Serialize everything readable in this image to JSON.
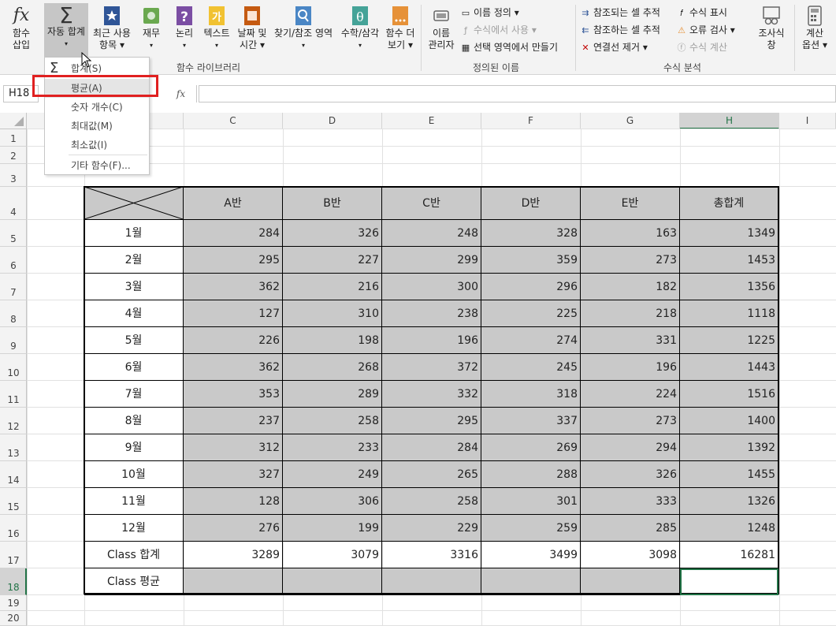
{
  "ribbon": {
    "insert_function": {
      "icon": "fx-icon",
      "line1": "함수",
      "line2": "삽입"
    },
    "autosum": {
      "icon": "sigma-icon",
      "line1": "자동 합계"
    },
    "recent": {
      "line1": "최근 사용",
      "line2": "항목"
    },
    "financial": {
      "line1": "재무"
    },
    "logical": {
      "line1": "논리"
    },
    "text": {
      "line1": "텍스트"
    },
    "datetime": {
      "line1": "날짜 및",
      "line2": "시간"
    },
    "lookup": {
      "line1": "찾기/참조 영역"
    },
    "math": {
      "line1": "수학/삼각"
    },
    "more": {
      "line1": "함수 더",
      "line2": "보기"
    },
    "library_label": "함수 라이브러리",
    "name_manager": {
      "line1": "이름",
      "line2": "관리자"
    },
    "define_name": "이름 정의",
    "use_in_formula": "수식에서 사용",
    "create_from_selection": "선택 영역에서 만들기",
    "defined_names_label": "정의된 이름",
    "trace_precedents": "참조되는 셀 추적",
    "trace_dependents": "참조하는 셀 추적",
    "remove_arrows": "연결선 제거",
    "show_formulas": "수식 표시",
    "error_checking": "오류 검사",
    "evaluate_formula": "수식 계산",
    "audit_label": "수식 분석",
    "watch_window": {
      "line1": "조사식",
      "line2": "창"
    },
    "calc_options": {
      "line1": "계산",
      "line2": "옵션"
    }
  },
  "formula_bar": {
    "name_box": "H18",
    "fx": "fx",
    "value": ""
  },
  "columns": [
    "C",
    "D",
    "E",
    "F",
    "G",
    "H",
    "I"
  ],
  "rows": [
    "1",
    "2",
    "3",
    "4",
    "5",
    "6",
    "7",
    "8",
    "9",
    "10",
    "11",
    "12",
    "13",
    "14",
    "15",
    "16",
    "17",
    "18",
    "19",
    "20"
  ],
  "table": {
    "headers": [
      "A반",
      "B반",
      "C반",
      "D반",
      "E반",
      "총합계"
    ],
    "data": [
      {
        "label": "1월",
        "values": [
          "284",
          "326",
          "248",
          "328",
          "163",
          "1349"
        ]
      },
      {
        "label": "2월",
        "values": [
          "295",
          "227",
          "299",
          "359",
          "273",
          "1453"
        ]
      },
      {
        "label": "3월",
        "values": [
          "362",
          "216",
          "300",
          "296",
          "182",
          "1356"
        ]
      },
      {
        "label": "4월",
        "values": [
          "127",
          "310",
          "238",
          "225",
          "218",
          "1118"
        ]
      },
      {
        "label": "5월",
        "values": [
          "226",
          "198",
          "196",
          "274",
          "331",
          "1225"
        ]
      },
      {
        "label": "6월",
        "values": [
          "362",
          "268",
          "372",
          "245",
          "196",
          "1443"
        ]
      },
      {
        "label": "7월",
        "values": [
          "353",
          "289",
          "332",
          "318",
          "224",
          "1516"
        ]
      },
      {
        "label": "8월",
        "values": [
          "237",
          "258",
          "295",
          "337",
          "273",
          "1400"
        ]
      },
      {
        "label": "9월",
        "values": [
          "312",
          "233",
          "284",
          "269",
          "294",
          "1392"
        ]
      },
      {
        "label": "10월",
        "values": [
          "327",
          "249",
          "265",
          "288",
          "326",
          "1455"
        ]
      },
      {
        "label": "11월",
        "values": [
          "128",
          "306",
          "258",
          "301",
          "333",
          "1326"
        ]
      },
      {
        "label": "12월",
        "values": [
          "276",
          "199",
          "229",
          "259",
          "285",
          "1248"
        ]
      }
    ],
    "total": {
      "label": "Class 합계",
      "values": [
        "3289",
        "3079",
        "3316",
        "3499",
        "3098",
        "16281"
      ]
    },
    "average": {
      "label": "Class 평균",
      "values": [
        "",
        "",
        "",
        "",
        "",
        ""
      ]
    }
  },
  "autosum_menu": {
    "items": [
      {
        "text": "합계(S)",
        "icon": "sigma-icon"
      },
      {
        "text": "평균(A)",
        "selected": true
      },
      {
        "text": "숫자 개수(C)"
      },
      {
        "text": "최대값(M)"
      },
      {
        "text": "최소값(I)"
      },
      {
        "text": "기타 함수(F)..."
      }
    ]
  },
  "colors": {
    "highlight": "#e02020",
    "selected": "#217346",
    "cell_fill": "#c9c9c9"
  }
}
